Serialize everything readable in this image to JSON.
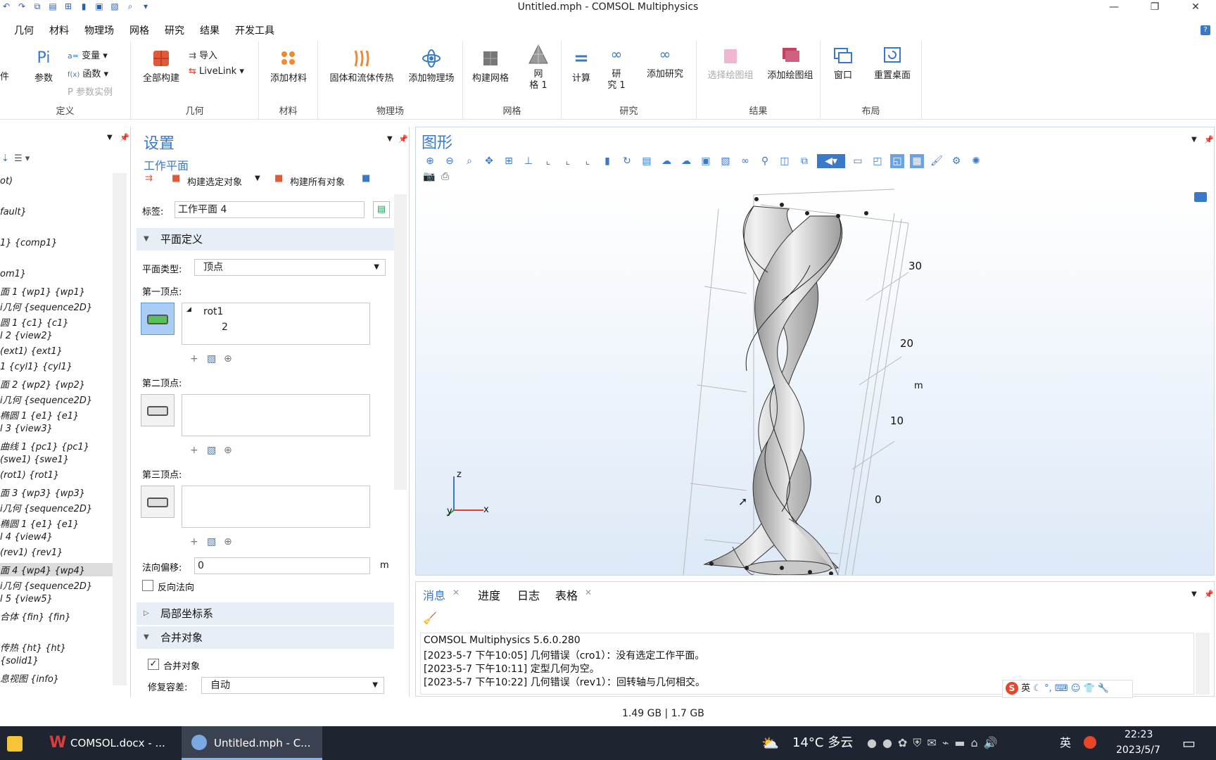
{
  "window": {
    "title": "Untitled.mph - COMSOL Multiphysics"
  },
  "menu": [
    "几何",
    "材料",
    "物理场",
    "网格",
    "研究",
    "结果",
    "开发工具"
  ],
  "ribbon": {
    "left_partial": "件",
    "definition": {
      "params": "参数",
      "variables": "变量",
      "functions": "函数",
      "param_instances": "参数实例",
      "group": "定义"
    },
    "geometry": {
      "build_all": "全部构建",
      "import": "导入",
      "livelink": "LiveLink",
      "group": "几何"
    },
    "materials": {
      "add": "添加材料",
      "group": "材料"
    },
    "physics": {
      "heat": "固体和流体传热",
      "add": "添加物理场",
      "group": "物理场"
    },
    "mesh": {
      "build": "构建网格",
      "mesh_line1": "网",
      "mesh_line2": "格 1",
      "group": "网格"
    },
    "study": {
      "compute": "计算",
      "study_line1": "研",
      "study_line2": "究 1",
      "add": "添加研究",
      "group": "研究"
    },
    "results": {
      "select_plot": "选择绘图组",
      "add_plot": "添加绘图组",
      "group": "结果"
    },
    "layout": {
      "window": "窗口",
      "reset": "重置桌面",
      "group": "布局"
    }
  },
  "tree": {
    "items": [
      "ot)",
      "fault}",
      "1} {comp1}",
      "om1}",
      "面 1 {wp1} {wp1}",
      "i几何 {sequence2D}",
      "圆 1 {c1} {c1}",
      "l 2 {view2}",
      "(ext1) {ext1}",
      "1 {cyl1} {cyl1}",
      "面 2 {wp2} {wp2}",
      "i几何 {sequence2D}",
      "椭圆 1 {e1} {e1}",
      "l 3 {view3}",
      "曲线 1 {pc1} {pc1}",
      "(swe1) {swe1}",
      "(rot1) {rot1}",
      "面 3 {wp3} {wp3}",
      "i几何 {sequence2D}",
      "椭圆 1 {e1} {e1}",
      "l 4 {view4}",
      "(rev1) {rev1}",
      "面 4 {wp4} {wp4}",
      "i几何 {sequence2D}",
      "l 5 {view5}",
      "合体 {fin} {fin}",
      "传热 {ht} {ht}",
      "{solid1}",
      "息视图 {info}"
    ]
  },
  "settings": {
    "title": "设置",
    "subtitle": "工作平面",
    "build_selected": "构建选定对象",
    "build_all": "构建所有对象",
    "label_field": "标签:",
    "label_value": "工作平面 4",
    "plane_def": "平面定义",
    "plane_type_label": "平面类型:",
    "plane_type_value": "顶点",
    "first_vertex": "第一顶点:",
    "first_vertex_items": [
      "rot1",
      "2"
    ],
    "second_vertex": "第二顶点:",
    "third_vertex": "第三顶点:",
    "normal_offset_label": "法向偏移:",
    "normal_offset_value": "0",
    "unit": "m",
    "reverse_normal": "反向法向",
    "local_cs": "局部坐标系",
    "union": "合并对象",
    "union_check": "合并对象",
    "repair_tol_label": "修复容差:",
    "repair_tol_value": "自动"
  },
  "graphics": {
    "title": "图形",
    "axis_ticks": [
      "30",
      "20",
      "10",
      "0"
    ],
    "axis_unit": "m",
    "triad": {
      "z": "z",
      "y": "y",
      "x": "x"
    }
  },
  "messages": {
    "tabs": [
      "消息",
      "进度",
      "日志",
      "表格"
    ],
    "lines": [
      "COMSOL Multiphysics 5.6.0.280",
      "[2023-5-7 下午10:05] 几何错误（cro1）：没有选定工作平面。",
      "[2023-5-7 下午10:11] 定型几何为空。",
      "[2023-5-7 下午10:22] 几何错误（rev1）：回转轴与几何相交。"
    ]
  },
  "status": {
    "memory": "1.49 GB | 1.7 GB"
  },
  "ime": {
    "label": "英"
  },
  "taskbar": {
    "items": [
      "COMSOL.docx - ...",
      "Untitled.mph - C..."
    ],
    "weather": "14°C 多云",
    "lang": "英",
    "time": "22:23",
    "date": "2023/5/7"
  },
  "colors": {
    "accent": "#3a78c8",
    "taskbar": "#1e2531"
  }
}
